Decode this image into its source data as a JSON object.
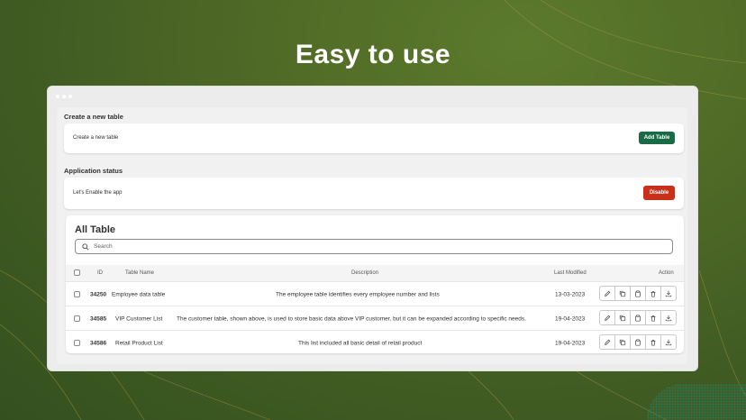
{
  "headline": "Easy to use",
  "create_section": {
    "title": "Create a new table",
    "text": "Create a new table",
    "button_label": "Add Table"
  },
  "status_section": {
    "title": "Application status",
    "text": "Let's Enable the app",
    "button_label": "Disable"
  },
  "table_section": {
    "title": "All Table",
    "search_placeholder": "Search",
    "columns": {
      "id": "ID",
      "name": "Table Name",
      "description": "Description",
      "modified": "Last Modified",
      "action": "Action"
    },
    "rows": [
      {
        "id": "34250",
        "name": "Employee data table",
        "description": "The employee table identifies every employee number and lists",
        "modified": "13-03-2023"
      },
      {
        "id": "34585",
        "name": "VIP Customer List",
        "description": "The customer table, shown above, is used to store basic data above VIP customer, but it can be expanded according to specific needs.",
        "modified": "19-04-2023"
      },
      {
        "id": "34586",
        "name": "Retail Product List",
        "description": "This list included all basic detail of retail product",
        "modified": "19-04-2023"
      }
    ]
  },
  "colors": {
    "primary_button": "#1a6b45",
    "danger_button": "#c9301c",
    "background": "#4f6a26"
  },
  "icons": [
    "pencil-icon",
    "duplicate-icon",
    "clipboard-icon",
    "trash-icon",
    "download-icon"
  ]
}
